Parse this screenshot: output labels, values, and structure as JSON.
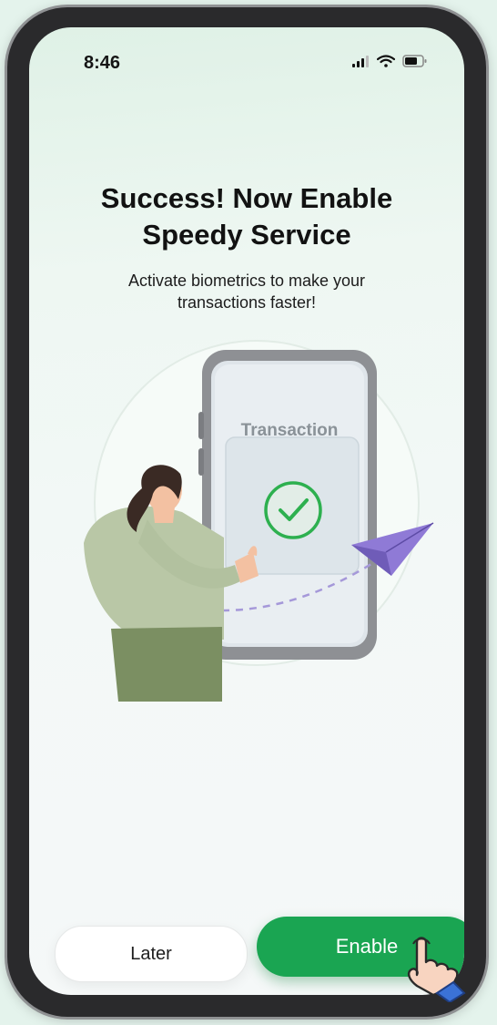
{
  "status_bar": {
    "time": "8:46",
    "icons": [
      "cellular-signal-icon",
      "wifi-icon",
      "battery-icon"
    ]
  },
  "heading": {
    "line1": "Success! Now Enable",
    "line2": "Speedy Service"
  },
  "subtitle": {
    "line1": "Activate biometrics to make your",
    "line2": "transactions faster!"
  },
  "illustration": {
    "phone_label": "Transaction",
    "icons": [
      "check-circle-icon",
      "paper-plane-icon"
    ]
  },
  "actions": {
    "later_label": "Later",
    "enable_label": "Enable"
  },
  "colors": {
    "accent_green": "#1aa552",
    "check_green": "#2db04f",
    "plane_purple": "#8f7ad6"
  }
}
